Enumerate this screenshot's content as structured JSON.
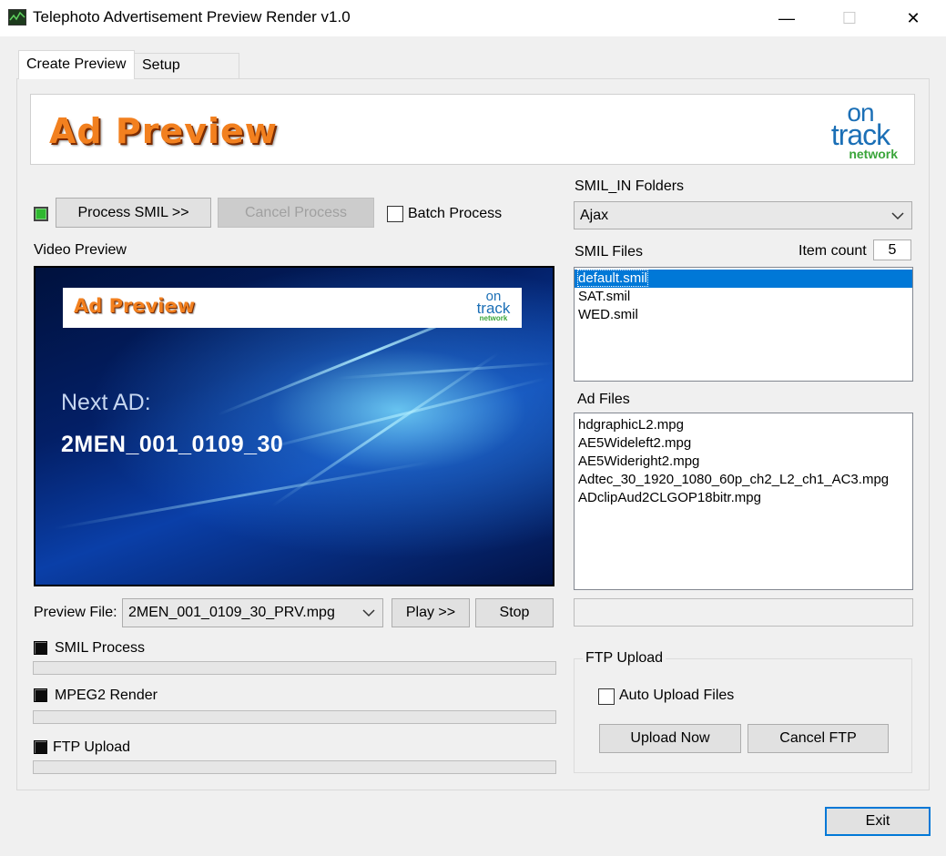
{
  "window": {
    "title": "Telephoto Advertisement Preview Render v1.0",
    "minimize": "—",
    "maximize": "☐",
    "close": "✕"
  },
  "tabs": [
    {
      "label": "Create Preview",
      "active": true
    },
    {
      "label": "Setup",
      "active": false
    }
  ],
  "banner": {
    "title": "Ad Preview",
    "logo": {
      "line1": "on",
      "line2": "track",
      "line3": "network"
    }
  },
  "controls": {
    "process_smil": "Process SMIL >>",
    "cancel_process": "Cancel Process",
    "batch_process": "Batch Process",
    "batch_checked": false
  },
  "video": {
    "label": "Video Preview",
    "overlay_title": "Ad Preview",
    "next_label": "Next AD:",
    "next_value": "2MEN_001_0109_30"
  },
  "preview": {
    "label": "Preview File:",
    "selected": "2MEN_001_0109_30_PRV.mpg",
    "play": "Play >>",
    "stop": "Stop"
  },
  "status": [
    {
      "label": "SMIL Process",
      "progress": 0
    },
    {
      "label": "MPEG2 Render",
      "progress": 0
    },
    {
      "label": "FTP Upload",
      "progress": 0
    }
  ],
  "smil_in": {
    "label": "SMIL_IN Folders",
    "selected": "Ajax"
  },
  "smil_files": {
    "label": "SMIL Files",
    "item_count_label": "Item count",
    "item_count": "5",
    "items": [
      "default.smil",
      "SAT.smil",
      "WED.smil"
    ],
    "selected_index": 0
  },
  "ad_files": {
    "label": "Ad Files",
    "items": [
      "hdgraphicL2.mpg",
      "AE5Wideleft2.mpg",
      "AE5Wideright2.mpg",
      "Adtec_30_1920_1080_60p_ch2_L2_ch1_AC3.mpg",
      "ADclipAud2CLGOP18bitr.mpg"
    ]
  },
  "ftp": {
    "group_label": "FTP Upload",
    "auto_upload": "Auto Upload Files",
    "auto_checked": false,
    "upload_now": "Upload Now",
    "cancel_ftp": "Cancel FTP"
  },
  "exit": "Exit",
  "colors": {
    "accent": "#0078d7",
    "banner_orange": "#f2801f",
    "logo_blue": "#1b6fb6",
    "logo_green": "#3aa53a",
    "led_green": "#2fb830"
  }
}
